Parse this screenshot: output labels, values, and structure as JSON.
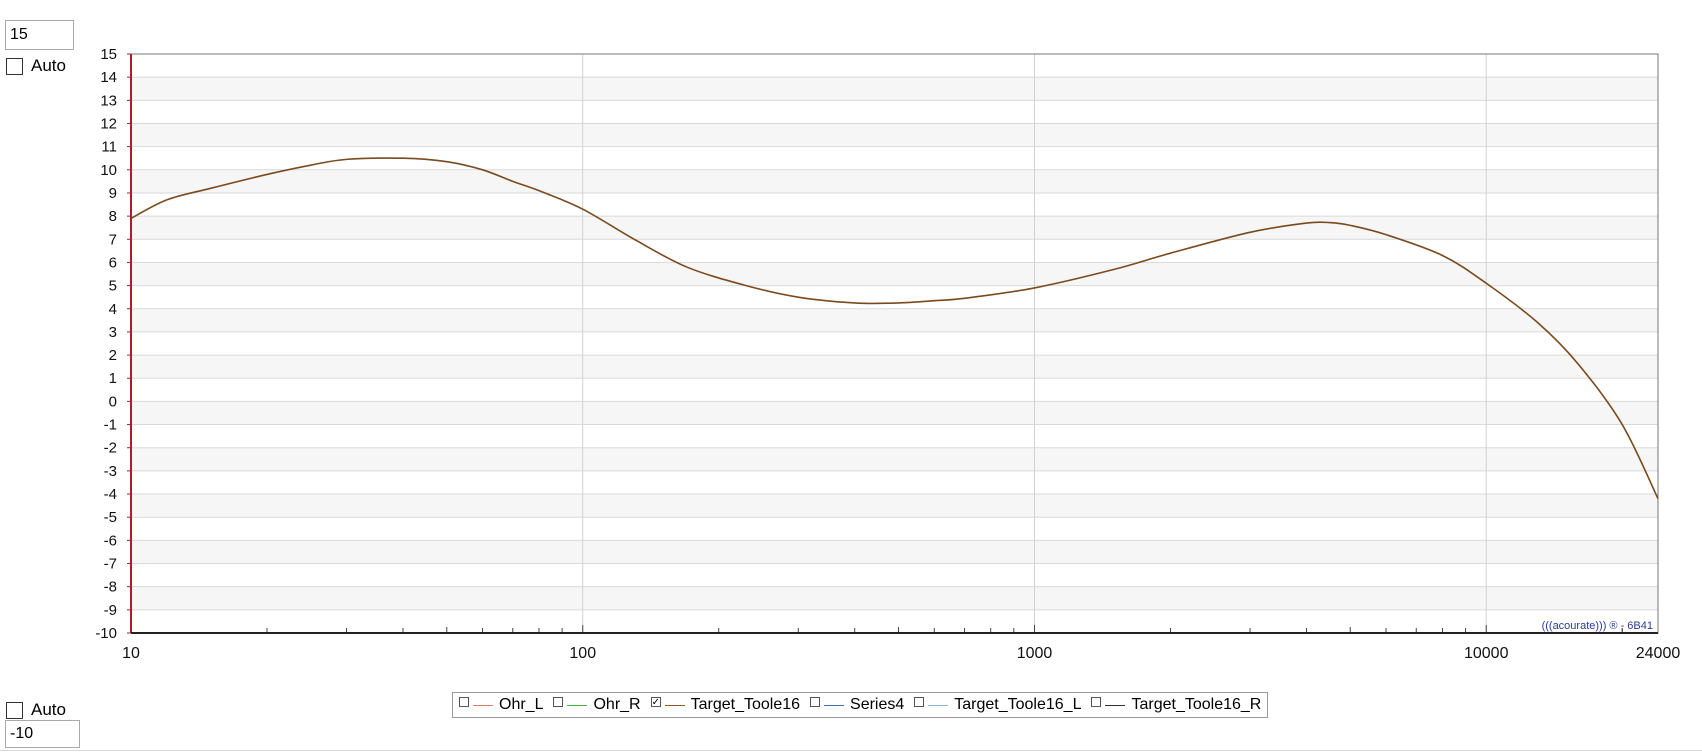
{
  "controls": {
    "ymax_value": "15",
    "auto_top_label": "Auto",
    "auto_bottom_label": "Auto",
    "ymin_value": "-10"
  },
  "watermark": "(((acourate))) ® - 6B41",
  "legend": [
    {
      "label": "Ohr_L",
      "checked": false,
      "color": "#d97b6c"
    },
    {
      "label": "Ohr_R",
      "checked": false,
      "color": "#4caf50"
    },
    {
      "label": "Target_Toole16",
      "checked": true,
      "color": "#8b5a2b"
    },
    {
      "label": "Series4",
      "checked": false,
      "color": "#4a6fa5"
    },
    {
      "label": "Target_Toole16_L",
      "checked": false,
      "color": "#8fb8d8"
    },
    {
      "label": "Target_Toole16_R",
      "checked": false,
      "color": "#333333"
    }
  ],
  "chart_data": {
    "type": "line",
    "x_scale": "log",
    "xlim": [
      10,
      24000
    ],
    "ylim": [
      -10,
      15
    ],
    "x_ticks": [
      "10",
      "100",
      "1000",
      "10000",
      "24000"
    ],
    "y_ticks": [
      "15",
      "14",
      "13",
      "12",
      "11",
      "10",
      "9",
      "8",
      "7",
      "6",
      "5",
      "4",
      "3",
      "2",
      "1",
      "0",
      "-1",
      "-2",
      "-3",
      "-4",
      "-5",
      "-6",
      "-7",
      "-8",
      "-9",
      "-10"
    ],
    "grid": true,
    "series": [
      {
        "name": "Target_Toole16",
        "color": "#7a4a1e",
        "x": [
          10,
          12,
          15,
          20,
          25,
          30,
          40,
          50,
          60,
          70,
          80,
          100,
          130,
          170,
          230,
          300,
          400,
          500,
          600,
          700,
          1000,
          1500,
          2000,
          3000,
          4000,
          4500,
          5000,
          6000,
          8000,
          10000,
          13000,
          16000,
          20000,
          24000
        ],
        "y": [
          7.9,
          8.7,
          9.2,
          9.8,
          10.2,
          10.45,
          10.5,
          10.35,
          10.0,
          9.5,
          9.1,
          8.3,
          7.0,
          5.8,
          5.0,
          4.5,
          4.25,
          4.25,
          4.35,
          4.45,
          4.9,
          5.7,
          6.4,
          7.3,
          7.7,
          7.72,
          7.6,
          7.2,
          6.3,
          5.1,
          3.4,
          1.6,
          -1.0,
          -4.2
        ]
      }
    ]
  }
}
